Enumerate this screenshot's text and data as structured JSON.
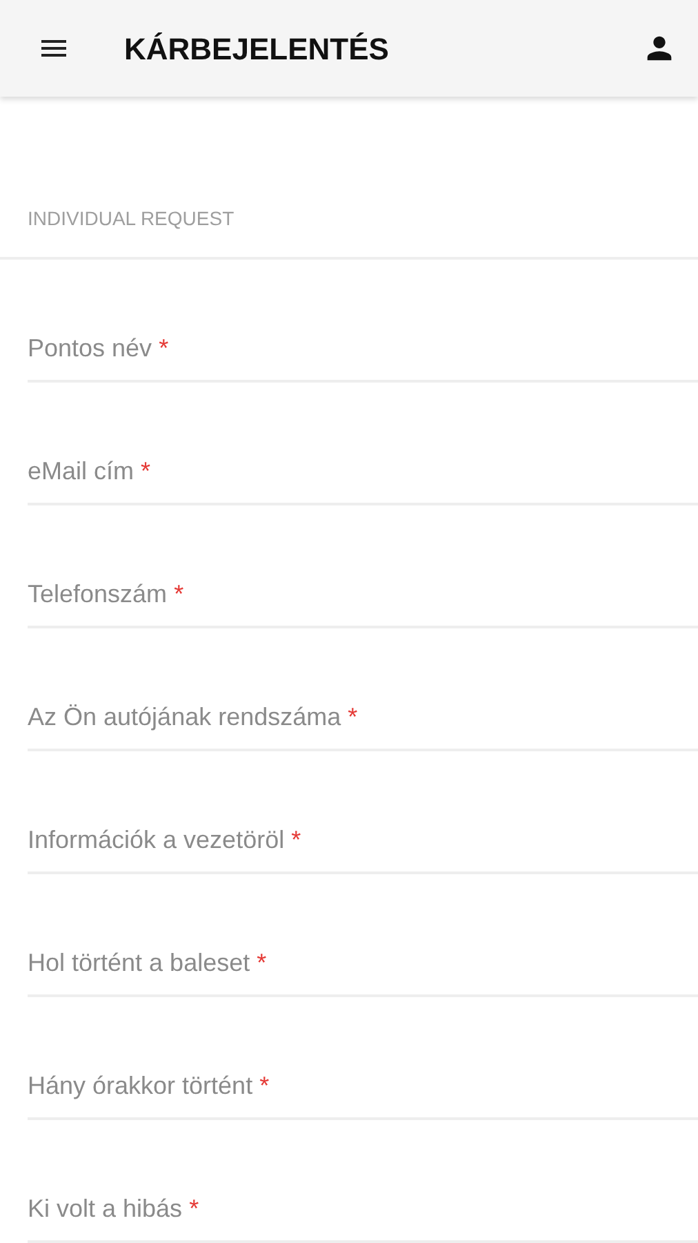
{
  "app_bar": {
    "title": "KÁRBEJELENTÉS"
  },
  "section": {
    "title": "INDIVIDUAL REQUEST"
  },
  "fields": [
    {
      "label": "Pontos név",
      "required_mark": "*"
    },
    {
      "label": "eMail cím",
      "required_mark": "*"
    },
    {
      "label": "Telefonszám",
      "required_mark": "*"
    },
    {
      "label": "Az Ön autójának rendszáma",
      "required_mark": "*"
    },
    {
      "label": "Információk a vezetöröl",
      "required_mark": "*"
    },
    {
      "label": "Hol történt a baleset",
      "required_mark": "*"
    },
    {
      "label": "Hány órakkor történt",
      "required_mark": "*"
    },
    {
      "label": "Ki volt a hibás",
      "required_mark": "*"
    }
  ]
}
